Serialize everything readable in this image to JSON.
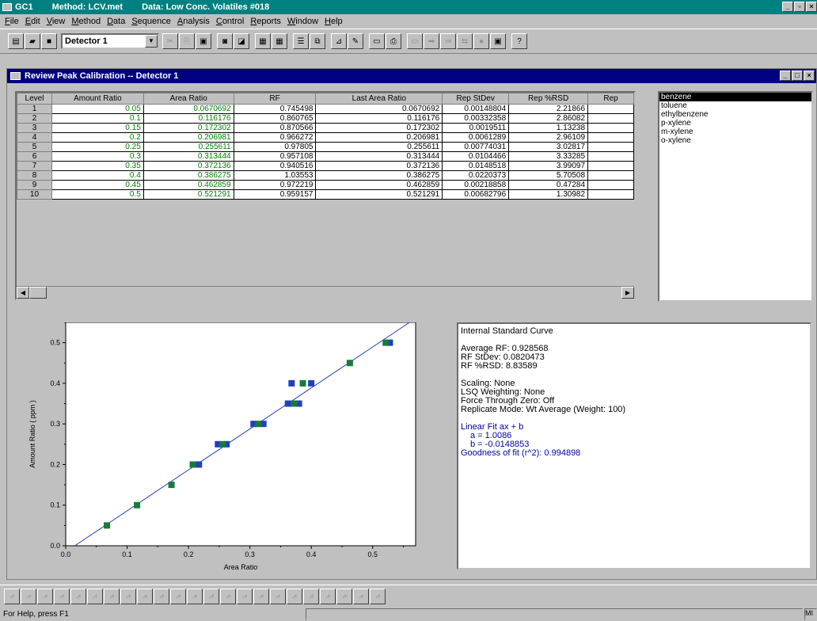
{
  "app": {
    "title_app": "GC1",
    "title_method": "Method: LCV.met",
    "title_data": "Data: Low Conc. Volatiles #018"
  },
  "menu": [
    "File",
    "Edit",
    "View",
    "Method",
    "Data",
    "Sequence",
    "Analysis",
    "Control",
    "Reports",
    "Window",
    "Help"
  ],
  "toolbar": {
    "detector": "Detector 1",
    "help_icon": "?"
  },
  "window": {
    "title": "Review Peak Calibration -- Detector 1"
  },
  "table": {
    "headers": [
      "Level",
      "Amount Ratio",
      "Area Ratio",
      "RF",
      "Last Area Ratio",
      "Rep StDev",
      "Rep %RSD",
      "Rep"
    ],
    "rows": [
      [
        "1",
        "0.05",
        "0.0670692",
        "0.745498",
        "0.0670692",
        "0.00148804",
        "2.21866"
      ],
      [
        "2",
        "0.1",
        "0.116176",
        "0.860765",
        "0.116176",
        "0.00332358",
        "2.86082"
      ],
      [
        "3",
        "0.15",
        "0.172302",
        "0.870566",
        "0.172302",
        "0.0019511",
        "1.13238"
      ],
      [
        "4",
        "0.2",
        "0.206981",
        "0.966272",
        "0.206981",
        "0.0061289",
        "2.96109"
      ],
      [
        "5",
        "0.25",
        "0.255611",
        "0.97805",
        "0.255611",
        "0.00774031",
        "3.02817"
      ],
      [
        "6",
        "0.3",
        "0.313444",
        "0.957108",
        "0.313444",
        "0.0104466",
        "3.33285"
      ],
      [
        "7",
        "0.35",
        "0.372136",
        "0.940516",
        "0.372136",
        "0.0148518",
        "3.99097"
      ],
      [
        "8",
        "0.4",
        "0.386275",
        "1.03553",
        "0.386275",
        "0.0220373",
        "5.70508"
      ],
      [
        "9",
        "0.45",
        "0.462859",
        "0.972219",
        "0.462859",
        "0.00218858",
        "0.47284"
      ],
      [
        "10",
        "0.5",
        "0.521291",
        "0.959157",
        "0.521291",
        "0.00682796",
        "1.30982"
      ]
    ]
  },
  "compounds": [
    "benzene",
    "toluene",
    "ethylbenzene",
    "p-xylene",
    "m-xylene",
    "o-xylene"
  ],
  "info": {
    "title": "Internal Standard Curve",
    "avg_rf": "Average RF: 0.928568",
    "rf_stdev": "RF StDev: 0.0820473",
    "rf_rsd": "RF %RSD: 8.83589",
    "scaling": "Scaling: None",
    "lsq": "LSQ Weighting: None",
    "force_zero": "Force Through Zero: Off",
    "replicate": "Replicate Mode: Wt Average (Weight: 100)",
    "fit": "Linear Fit   ax + b",
    "a": "a = 1.0086",
    "b": "b = -0.0148853",
    "goodness": "Goodness of fit (r^2): 0.994898"
  },
  "status": {
    "help": "For Help, press F1",
    "mode": "MI"
  },
  "colors": {
    "title": "#008080",
    "mdi_title": "#000080",
    "series_green": "#008000",
    "series_blue": "#2040c0"
  },
  "chart_data": {
    "type": "scatter",
    "xlabel": "Area Ratio",
    "ylabel": "Amount Ratio ( ppm )",
    "xlim": [
      0.0,
      0.57
    ],
    "ylim": [
      0.0,
      0.55
    ],
    "xticks": [
      "0.0",
      "0.1",
      "0.2",
      "0.3",
      "0.4",
      "0.5"
    ],
    "yticks": [
      "0.0",
      "0.1",
      "0.2",
      "0.3",
      "0.4",
      "0.5"
    ],
    "points": [
      {
        "x": 0.0670692,
        "y": 0.05
      },
      {
        "x": 0.116176,
        "y": 0.1
      },
      {
        "x": 0.172302,
        "y": 0.15
      },
      {
        "x": 0.206981,
        "y": 0.2
      },
      {
        "x": 0.255611,
        "y": 0.25
      },
      {
        "x": 0.313444,
        "y": 0.3
      },
      {
        "x": 0.372136,
        "y": 0.35
      },
      {
        "x": 0.386275,
        "y": 0.4
      },
      {
        "x": 0.462859,
        "y": 0.45
      },
      {
        "x": 0.521291,
        "y": 0.5
      }
    ],
    "replicates": [
      {
        "x": 0.217,
        "y": 0.2
      },
      {
        "x": 0.248,
        "y": 0.25
      },
      {
        "x": 0.262,
        "y": 0.25
      },
      {
        "x": 0.306,
        "y": 0.3
      },
      {
        "x": 0.322,
        "y": 0.3
      },
      {
        "x": 0.362,
        "y": 0.35
      },
      {
        "x": 0.38,
        "y": 0.35
      },
      {
        "x": 0.368,
        "y": 0.4
      },
      {
        "x": 0.4,
        "y": 0.4
      },
      {
        "x": 0.528,
        "y": 0.5
      }
    ],
    "fit": {
      "a": 1.0086,
      "b": -0.0148853
    }
  }
}
